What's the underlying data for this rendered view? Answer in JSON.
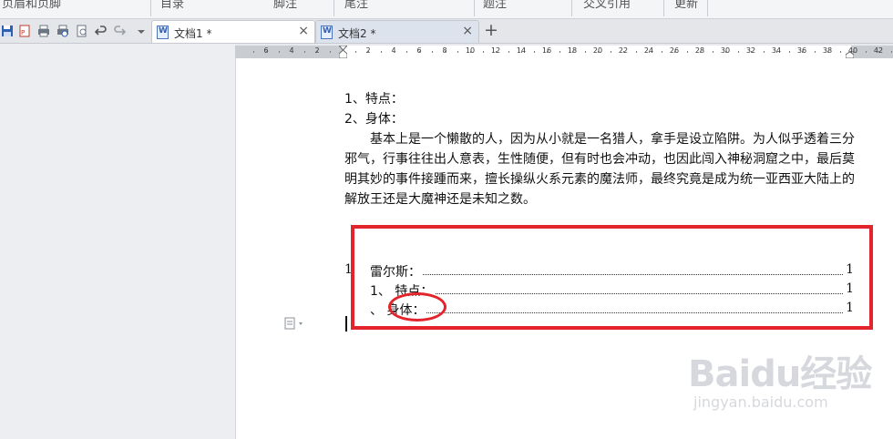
{
  "ribbon": {
    "items": [
      "页眉和页脚",
      "目录",
      "脚注",
      "尾注",
      "题注",
      "交叉引用",
      "更新"
    ]
  },
  "quick_toolbar": {
    "icons": [
      "save-icon",
      "export-pdf-icon",
      "print-icon",
      "print-preview-icon",
      "find-icon",
      "undo-icon",
      "redo-icon",
      "dropdown-icon"
    ]
  },
  "tabs": [
    {
      "label": "文档1 *",
      "close": "×",
      "active": true
    },
    {
      "label": "文档2 *",
      "close": "×",
      "active": false
    }
  ],
  "new_tab": "+",
  "ruler": {
    "numbers": [
      "6",
      "4",
      "2",
      "2",
      "2",
      "4",
      "6",
      "8",
      "10",
      "12",
      "14",
      "16",
      "18",
      "20",
      "22",
      "24",
      "26",
      "28",
      "30",
      "32",
      "34",
      "36",
      "38",
      "40",
      "42"
    ]
  },
  "document": {
    "line1": "1、特点：",
    "line2": "2、身体：",
    "para_lines": [
      "基本上是一个懒散的人，因为从小就是一名猎人，拿手是设立陷阱。为人似乎透着三分",
      "邪气，行事往往出人意表，生性随便，但有时也会冲动，也因此闯入神秘洞窟之中，最后莫",
      "明其妙的事件接踵而来，擅长操纵火系元素的魔法师，最终究竟是成为统一亚西亚大陆上的",
      "解放王还是大魔神还是未知之数。"
    ],
    "toc_prefix": "1",
    "toc": [
      {
        "label": "雷尔斯：",
        "page": "1"
      },
      {
        "label": "1、 特点：",
        "page": "1"
      },
      {
        "label": "、 身体：",
        "page": "1"
      }
    ]
  },
  "watermark": {
    "logo": "Baidu经验",
    "url": "jingyan.baidu.com"
  },
  "colors": {
    "highlight": "#e3242b",
    "tab_active": "#ffffff",
    "tab_inactive": "#dde3ec"
  }
}
